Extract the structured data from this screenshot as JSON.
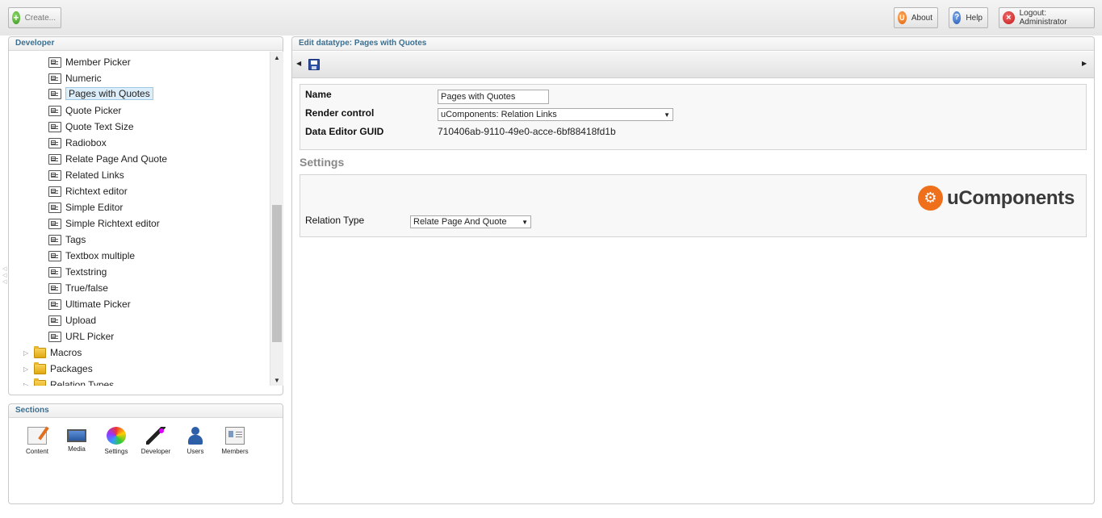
{
  "topbar": {
    "create_label": "Create...",
    "about_label": "About",
    "help_label": "Help",
    "logout_label": "Logout: Administrator"
  },
  "tree": {
    "title": "Developer",
    "datatypes": [
      "Member Picker",
      "Numeric",
      "Pages with Quotes",
      "Quote Picker",
      "Quote Text Size",
      "Radiobox",
      "Relate Page And Quote",
      "Related Links",
      "Richtext editor",
      "Simple Editor",
      "Simple Richtext editor",
      "Tags",
      "Textbox multiple",
      "Textstring",
      "True/false",
      "Ultimate Picker",
      "Upload",
      "URL Picker"
    ],
    "selected": "Pages with Quotes",
    "folders": [
      "Macros",
      "Packages",
      "Relation Types"
    ]
  },
  "sections": {
    "title": "Sections",
    "items": [
      "Content",
      "Media",
      "Settings",
      "Developer",
      "Users",
      "Members"
    ]
  },
  "editor": {
    "title": "Edit datatype: Pages with Quotes",
    "name_label": "Name",
    "name_value": "Pages with Quotes",
    "render_label": "Render control",
    "render_value": "uComponents: Relation Links",
    "guid_label": "Data Editor GUID",
    "guid_value": "710406ab-9110-49e0-acce-6bf88418fd1b",
    "settings_title": "Settings",
    "logo_text": "uComponents",
    "relation_label": "Relation Type",
    "relation_value": "Relate Page And Quote"
  },
  "colors": {
    "header_text": "#3c6e8f",
    "logo_orange": "#ef6f1a"
  }
}
